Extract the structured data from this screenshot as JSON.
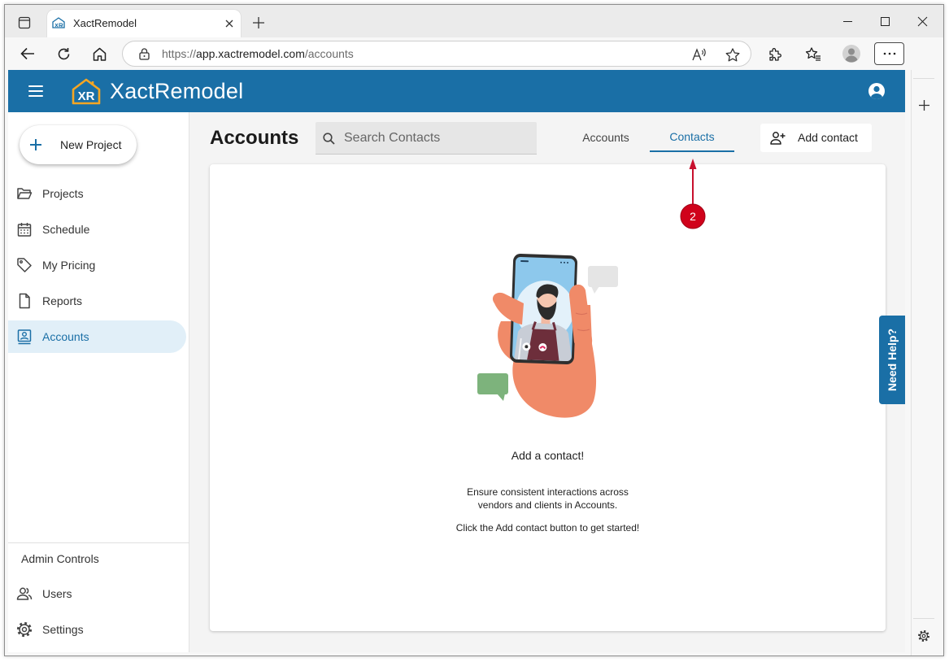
{
  "browser": {
    "tab_title": "XactRemodel",
    "url": {
      "scheme": "https://",
      "host": "app.xactremodel.com",
      "path": "/accounts"
    },
    "icons": [
      "tab-actions-icon",
      "xactremodel-favicon-icon",
      "close-icon",
      "plus-icon",
      "minimize-icon",
      "maximize-icon",
      "close-window-icon",
      "back-arrow-icon",
      "refresh-icon",
      "home-icon",
      "lock-icon",
      "read-aloud-icon",
      "star-icon",
      "extensions-icon",
      "favorites-icon",
      "profile-avatar-icon",
      "more-icon",
      "gear-icon"
    ]
  },
  "app": {
    "brand": "XactRemodel",
    "logo_text": "XR",
    "icons": [
      "hamburger-menu-icon",
      "account-circle-icon"
    ]
  },
  "sidebar": {
    "new_project_label": "New Project",
    "nav": [
      {
        "label": "Projects",
        "icon": "folder-icon",
        "active": false
      },
      {
        "label": "Schedule",
        "icon": "calendar-icon",
        "active": false
      },
      {
        "label": "My Pricing",
        "icon": "tag-icon",
        "active": false
      },
      {
        "label": "Reports",
        "icon": "document-icon",
        "active": false
      },
      {
        "label": "Accounts",
        "icon": "contact-card-icon",
        "active": true
      }
    ],
    "admin_heading": "Admin Controls",
    "admin_items": [
      {
        "label": "Users",
        "icon": "users-icon"
      },
      {
        "label": "Settings",
        "icon": "gear-icon"
      }
    ]
  },
  "main": {
    "title": "Accounts",
    "search": {
      "placeholder": "Search Contacts"
    },
    "tabs": [
      {
        "label": "Accounts",
        "active": false
      },
      {
        "label": "Contacts",
        "active": true
      }
    ],
    "add_contact_label": "Add contact",
    "empty_state": {
      "title": "Add a contact!",
      "lines": [
        "Ensure consistent interactions across",
        "vendors and clients in Accounts."
      ],
      "hint": "Click the Add contact button to get started!"
    }
  },
  "annotation": {
    "step": "2"
  },
  "help": {
    "label": "Need Help?"
  },
  "theme": {
    "accent": "#1a6fa6",
    "active_bg": "#e1eff8",
    "annotation_red": "#d0021b",
    "logo_orange": "#f5a623"
  }
}
